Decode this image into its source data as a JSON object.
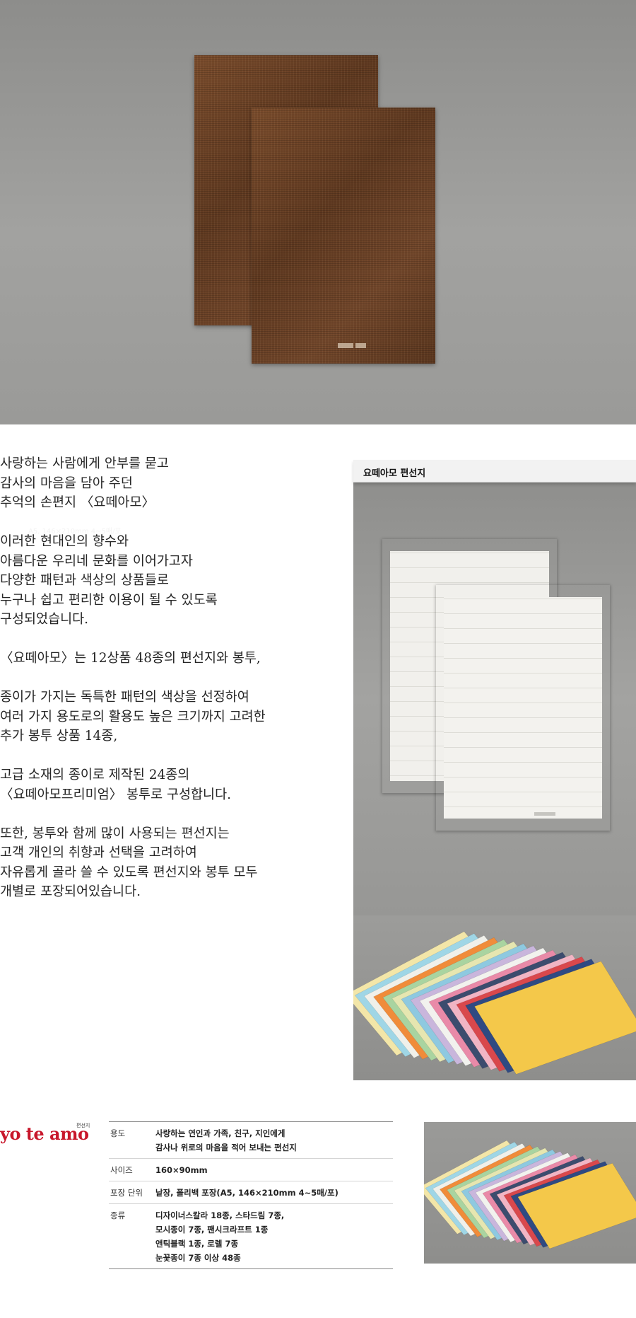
{
  "description": {
    "paragraphs": [
      [
        "사랑하는 사람에게 안부를 묻고",
        "감사의 마음을 담아 주던",
        "추억의 손편지 〈요떼아모〉"
      ],
      [
        "이러한 현대인의 향수와",
        "아름다운 우리네 문화를 이어가고자",
        "다양한 패턴과 색상의 상품들로",
        "누구나 쉽고 편리한 이용이 될 수 있도록",
        "구성되었습니다."
      ],
      [
        "〈요떼아모〉는 12상품 48종의 편선지와 봉투,"
      ],
      [
        "종이가 가지는 독특한 패턴의 색상을 선정하여",
        "여러 가지 용도로의 활용도 높은 크기까지 고려한",
        "추가 봉투 상품 14종,"
      ],
      [
        "고급 소재의 종이로 제작된 24종의",
        "〈요떼아모프리미엄〉 봉투로 구성합니다."
      ],
      [
        "또한, 봉투와 함께 많이 사용되는 편선지는",
        "고객 개인의 취향과 선택을 고려하여",
        "자유롭게 골라 쓸 수 있도록 편선지와 봉투 모두",
        "개별로 포장되어있습니다."
      ]
    ]
  },
  "panel": {
    "title": "요떼아모 편선지",
    "size_label": "A5, 146×210mm 4~5매/포"
  },
  "brand": {
    "logo_text": "yo te amo",
    "sub": "편선지"
  },
  "spec": [
    {
      "key": "용도",
      "lines": [
        "사랑하는 연인과 가족, 친구, 지인에게",
        "감사나 위로의 마음을 적어 보내는 편선지"
      ]
    },
    {
      "key": "사이즈",
      "lines": [
        "160×90mm"
      ]
    },
    {
      "key": "포장 단위",
      "lines": [
        "낱장, 폴리백 포장(A5, 146×210mm 4~5매/포)"
      ]
    },
    {
      "key": "종류",
      "lines": [
        "디자이너스칼라 18종, 스타드림 7종,",
        "모시종이 7종, 팬시크라프트 1종",
        "앤틱블랙 1종, 로렐 7종",
        "눈꽃종이 7종 이상 48종"
      ]
    }
  ],
  "fan_colors": [
    "#f3e6a8",
    "#9fd6e6",
    "#f0f0ea",
    "#f08c3a",
    "#a9d4a0",
    "#e6e6b0",
    "#8ec9e0",
    "#c9b6dc",
    "#f2f2ee",
    "#e98aa8",
    "#3c4c6e",
    "#f1b5c4",
    "#d9484c",
    "#2f4a82",
    "#f4c84a"
  ]
}
